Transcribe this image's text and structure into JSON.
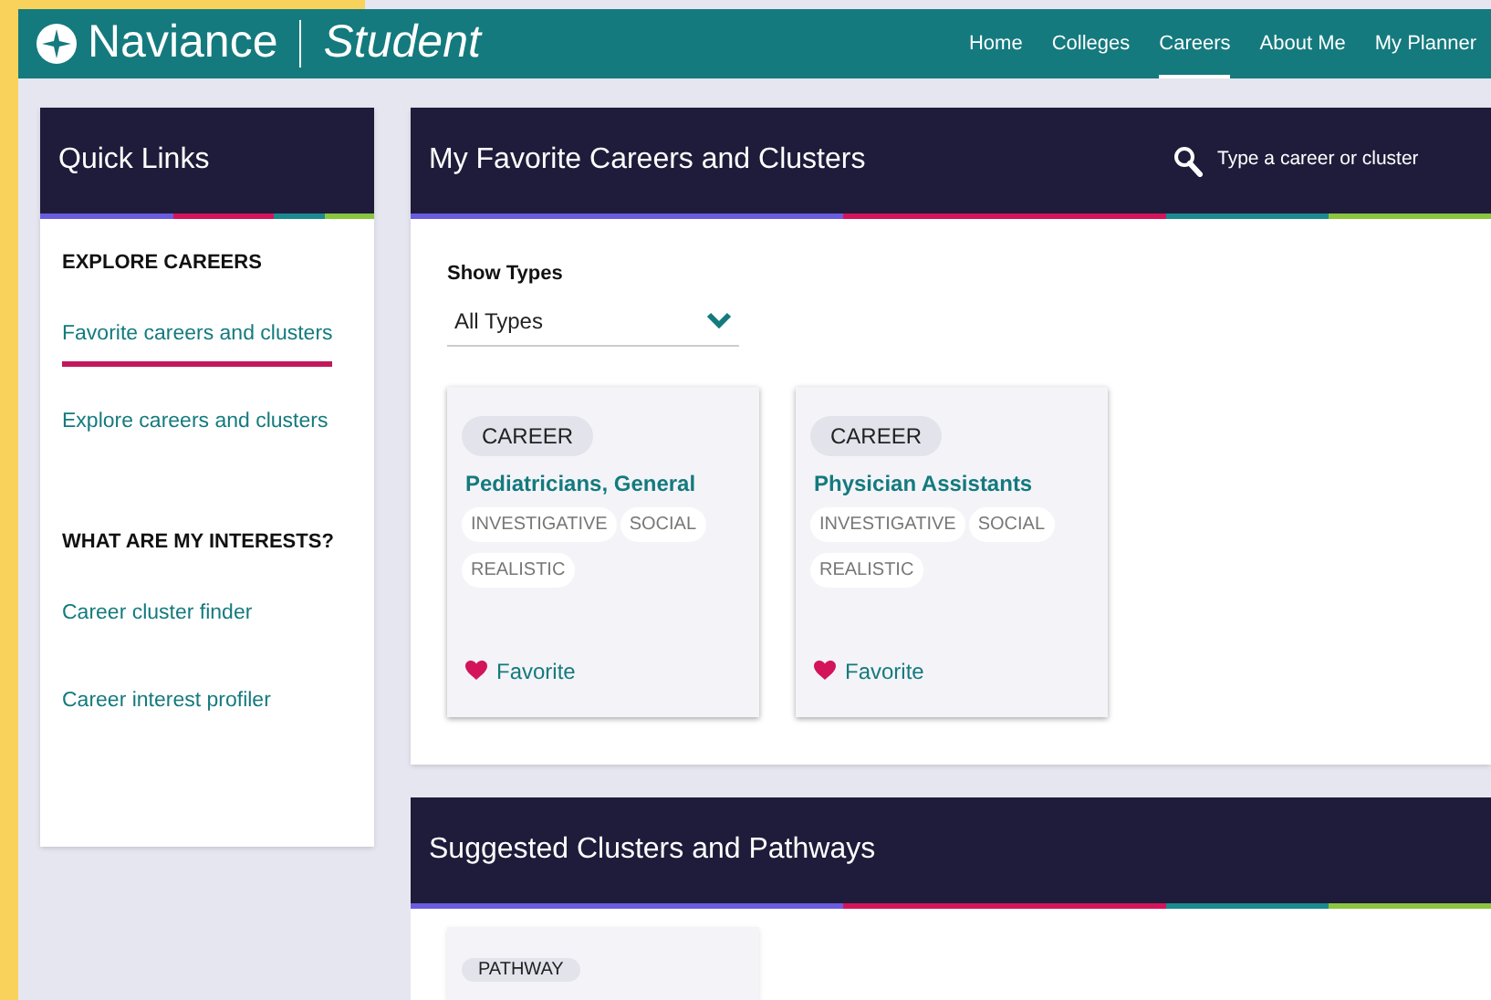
{
  "brand": {
    "name": "Naviance",
    "product": "Student"
  },
  "nav": [
    {
      "label": "Home",
      "selected": false
    },
    {
      "label": "Colleges",
      "selected": false
    },
    {
      "label": "Careers",
      "selected": true
    },
    {
      "label": "About Me",
      "selected": false
    },
    {
      "label": "My Planner",
      "selected": false
    }
  ],
  "quick_links": {
    "title": "Quick Links",
    "sections": [
      {
        "heading": "EXPLORE CAREERS",
        "items": [
          {
            "label": "Favorite careers and clusters",
            "selected": true
          },
          {
            "label": "Explore careers and clusters",
            "selected": false
          }
        ]
      },
      {
        "heading": "WHAT ARE MY INTERESTS?",
        "items": [
          {
            "label": "Career cluster finder",
            "selected": false
          },
          {
            "label": "Career interest profiler",
            "selected": false
          }
        ]
      }
    ]
  },
  "favorites": {
    "title": "My Favorite Careers and Clusters",
    "search": {
      "placeholder": "Type a career or cluster"
    },
    "filter": {
      "label": "Show Types",
      "value": "All Types"
    },
    "cards": [
      {
        "type": "CAREER",
        "name": "Pediatricians, General",
        "tags": [
          "INVESTIGATIVE",
          "SOCIAL",
          "REALISTIC"
        ],
        "favorite": "Favorite"
      },
      {
        "type": "CAREER",
        "name": "Physician Assistants",
        "tags": [
          "INVESTIGATIVE",
          "SOCIAL",
          "REALISTIC"
        ],
        "favorite": "Favorite"
      }
    ]
  },
  "suggested": {
    "title": "Suggested Clusters and Pathways",
    "cards": [
      {
        "type": "PATHWAY"
      }
    ]
  }
}
